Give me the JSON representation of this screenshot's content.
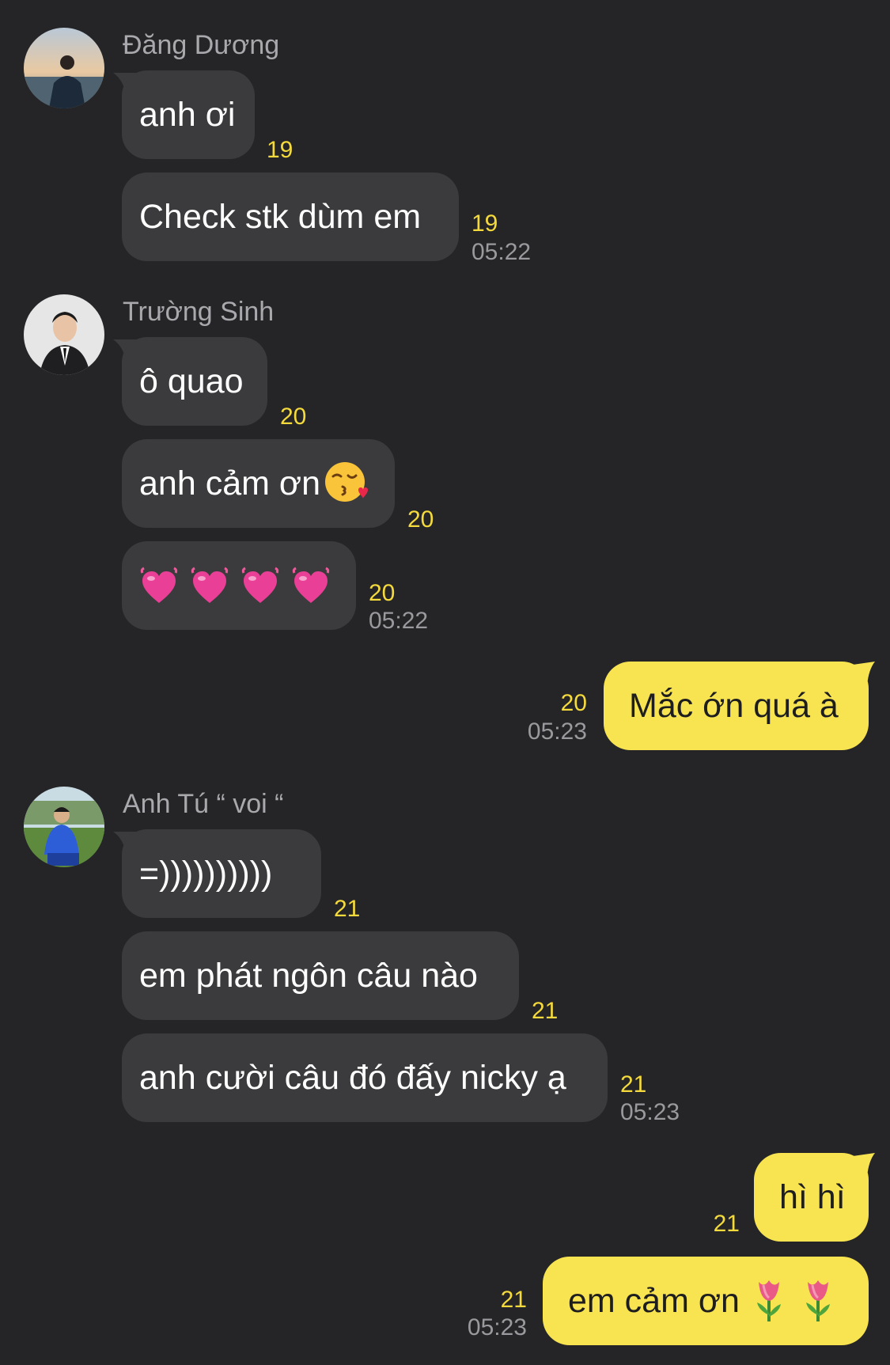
{
  "colors": {
    "background": "#252527",
    "incoming_bubble": "#3b3b3d",
    "outgoing_bubble": "#f8e451",
    "read_count": "#f4da3c",
    "timestamp": "#9a9a9e",
    "sender_name": "#a9a9ad"
  },
  "groups": [
    {
      "sender": "Đăng Dương",
      "avatar": "avatar-photo",
      "messages": [
        {
          "text": "anh ơi",
          "count": "19"
        },
        {
          "text": "Check stk dùm em",
          "count": "19",
          "time": "05:22"
        }
      ]
    },
    {
      "sender": "Trường Sinh",
      "avatar": "avatar-photo",
      "messages": [
        {
          "text": "ô quao",
          "count": "20"
        },
        {
          "text": "anh cảm ơn",
          "emoji": "kissing-face-heart-icon",
          "count": "20"
        },
        {
          "text": "",
          "emoji": "beating-heart-icon x4",
          "count": "20",
          "time": "05:22"
        }
      ]
    },
    {
      "outgoing": true,
      "messages": [
        {
          "text": "Mắc ớn quá à",
          "count": "20",
          "time": "05:23"
        }
      ]
    },
    {
      "sender": "Anh Tú “ voi “",
      "avatar": "avatar-photo",
      "messages": [
        {
          "text": "=))))))))))",
          "count": "21"
        },
        {
          "text": "em phát ngôn câu nào",
          "count": "21"
        },
        {
          "text": "anh cười câu đó đấy nicky ạ",
          "count": "21",
          "time": "05:23"
        }
      ]
    },
    {
      "outgoing": true,
      "messages": [
        {
          "text": "hì hì",
          "count": "21"
        },
        {
          "text": "em cảm ơn",
          "emoji": "tulip-icon x2",
          "count": "21",
          "time": "05:23"
        }
      ]
    }
  ]
}
